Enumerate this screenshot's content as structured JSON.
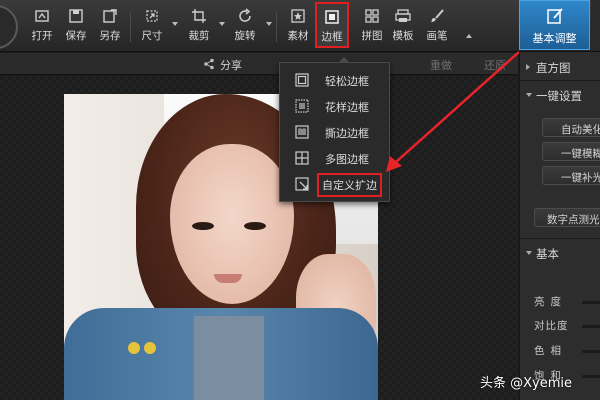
{
  "toolbar": {
    "items": [
      {
        "label": "打开",
        "icon": "open-icon"
      },
      {
        "label": "保存",
        "icon": "save-icon"
      },
      {
        "label": "另存",
        "icon": "save-as-icon"
      },
      {
        "label": "尺寸",
        "icon": "resize-icon"
      },
      {
        "label": "裁剪",
        "icon": "crop-icon"
      },
      {
        "label": "旋转",
        "icon": "rotate-icon"
      },
      {
        "label": "素材",
        "icon": "sticker-icon"
      },
      {
        "label": "边框",
        "icon": "border-icon"
      },
      {
        "label": "拼图",
        "icon": "collage-icon"
      },
      {
        "label": "模板",
        "icon": "template-icon"
      },
      {
        "label": "画笔",
        "icon": "brush-icon"
      }
    ],
    "active_item": "边框"
  },
  "panel_tab": {
    "label": "基本调整",
    "icon": "edit-icon"
  },
  "subbar": {
    "share": "分享",
    "redo": "重做",
    "more": "还原"
  },
  "dropdown": {
    "items": [
      {
        "label": "轻松边框",
        "icon": "simple-border-icon"
      },
      {
        "label": "花样边框",
        "icon": "pattern-border-icon"
      },
      {
        "label": "撕边边框",
        "icon": "torn-border-icon"
      },
      {
        "label": "多图边框",
        "icon": "multi-photo-border-icon"
      },
      {
        "label": "自定义扩边",
        "icon": "custom-extend-icon"
      }
    ],
    "highlighted": "自定义扩边"
  },
  "right_panel": {
    "histogram": "直方图",
    "one_click": "一键设置",
    "buttons": [
      "自动美化",
      "一键模糊",
      "一键补光"
    ],
    "digital_fill": "数字点测光",
    "basic": "基本",
    "sliders": [
      "亮度",
      "对比度",
      "色相",
      "饱和"
    ]
  },
  "watermark": "头条 @Xyemie",
  "colors": {
    "accent_blue": "#2f86c9",
    "highlight_red": "#e02020",
    "toolbar_bg": "#2e2e2e"
  }
}
